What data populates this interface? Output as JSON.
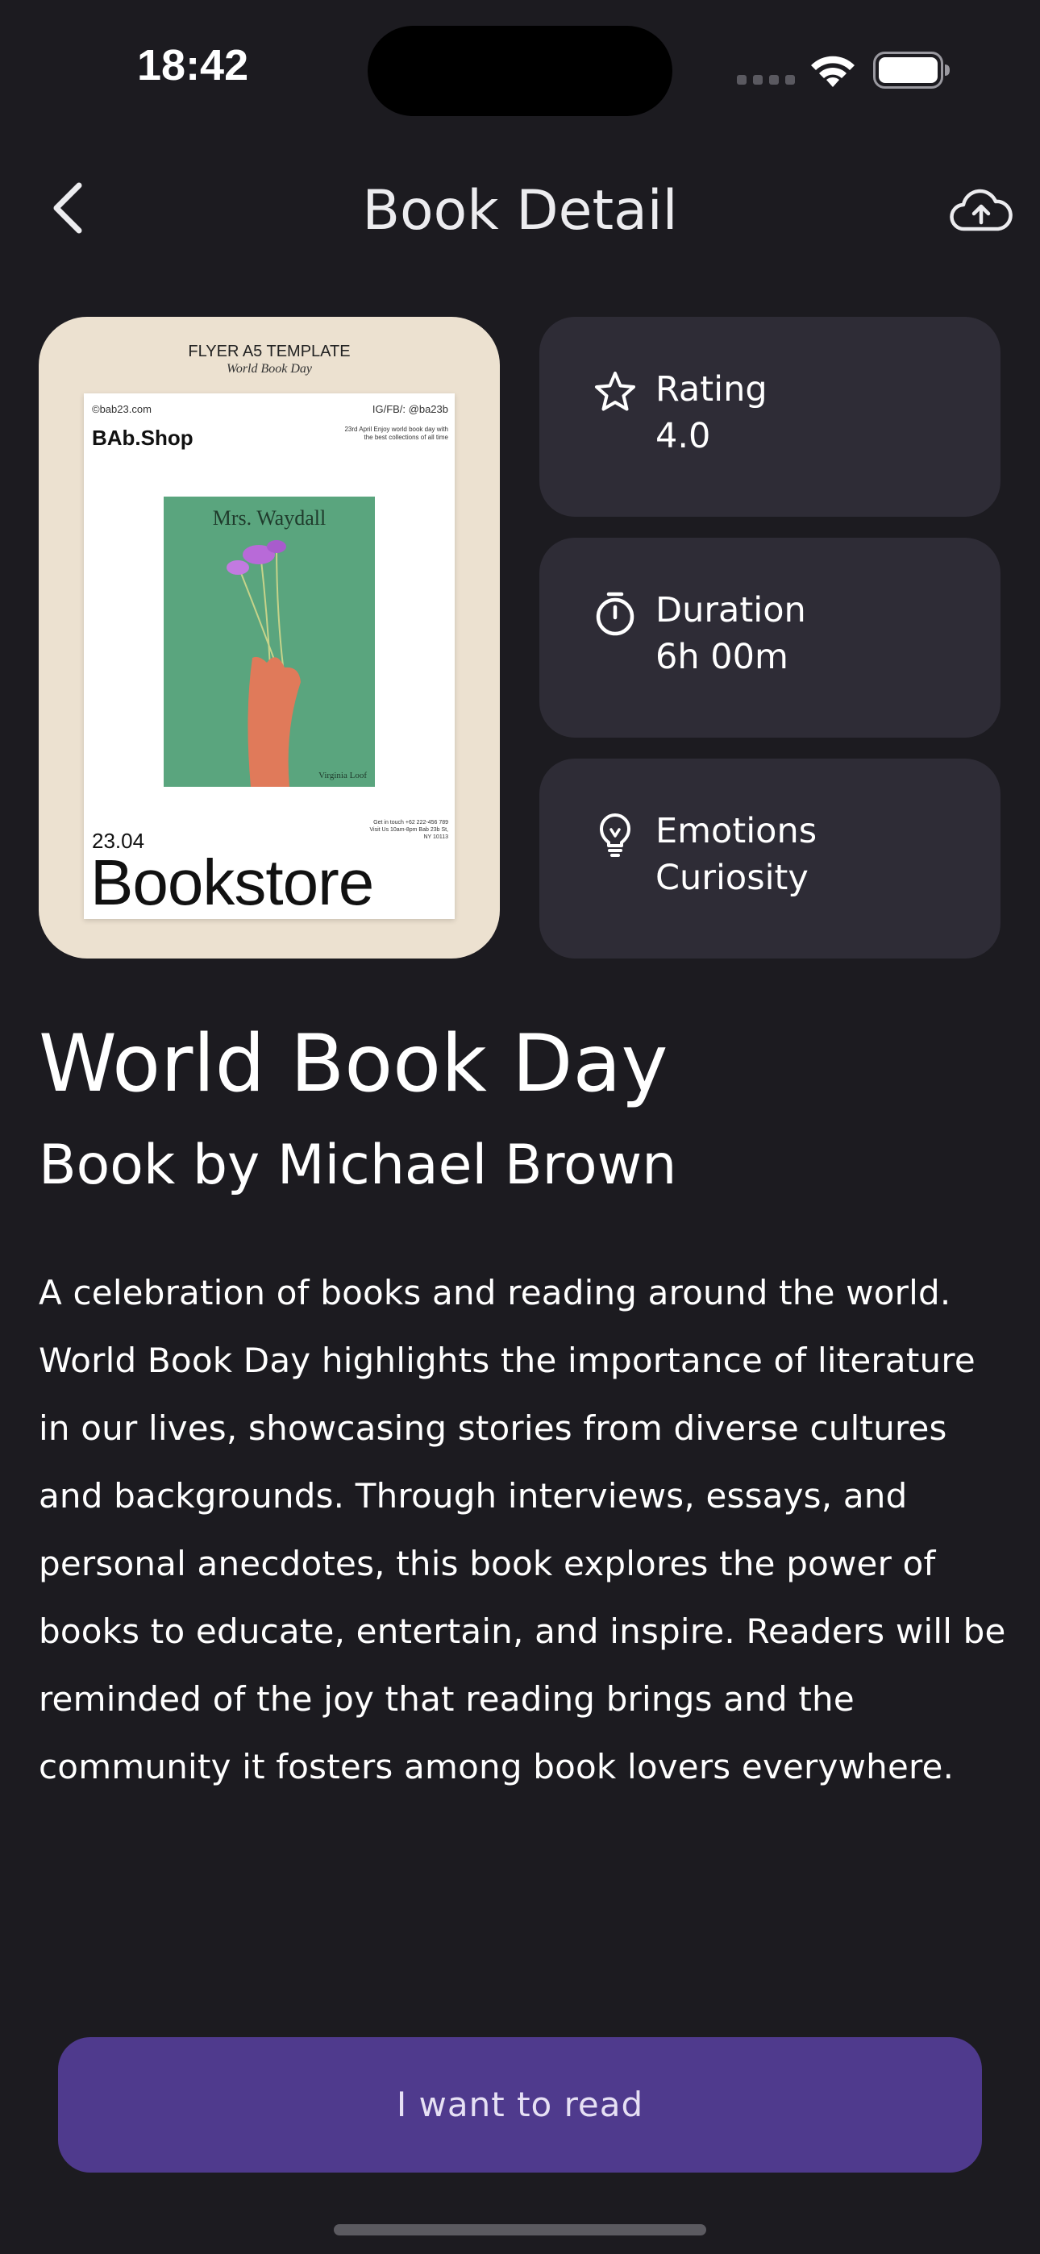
{
  "status_bar": {
    "time": "18:42"
  },
  "header": {
    "title": "Book Detail",
    "back_icon": "chevron-left-icon",
    "upload_icon": "cloud-upload-icon"
  },
  "cover": {
    "flyer_title": "FLYER A5 TEMPLATE",
    "flyer_subtitle": "World Book Day",
    "handle_left": "©bab23.com",
    "handle_right": "IG/FB/: @ba23b",
    "brand": "BAb.Shop",
    "note": "23rd April Enjoy world book day with the best collections of all time",
    "art_title": "Mrs. Waydall",
    "art_author": "Virginia Loof",
    "date": "23.04",
    "contact": "Get in touch +62 222-456 789 Visit Us 10am-8pm Bab 23b St, NY 10113",
    "store": "Bookstore"
  },
  "info_cards": [
    {
      "icon": "star-icon",
      "label": "Rating",
      "value": "4.0"
    },
    {
      "icon": "stopwatch-icon",
      "label": "Duration",
      "value": "6h 00m"
    },
    {
      "icon": "lightbulb-icon",
      "label": "Emotions",
      "value": "Curiosity"
    }
  ],
  "book": {
    "title": "World Book Day",
    "author": "Book by Michael Brown",
    "description": "A celebration of books and reading around the world. World Book Day highlights the importance of literature in our lives, showcasing stories from diverse cultures and backgrounds. Through interviews, essays, and personal anecdotes, this book explores the power of books to educate, entertain, and inspire. Readers will be reminded of the joy that reading brings and the community it fosters among book lovers everywhere."
  },
  "cta": {
    "label": "I want to read"
  },
  "colors": {
    "background": "#1c1b20",
    "card": "#2e2c36",
    "cover_bg": "#ece1d0",
    "cta": "#4f3a8d"
  }
}
